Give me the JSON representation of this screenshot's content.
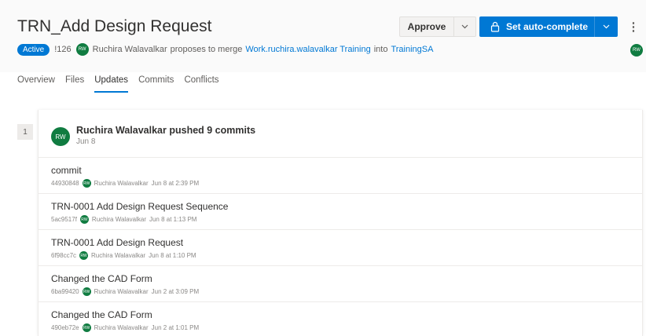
{
  "header": {
    "title": "TRN_Add Design Request",
    "approve_label": "Approve",
    "auto_complete_label": "Set auto-complete",
    "more_label": "⋮"
  },
  "meta": {
    "status": "Active",
    "pr_id": "!126",
    "author_initials": "RW",
    "author": "Ruchira Walavalkar",
    "proposes_text": "proposes to merge",
    "source_branch": "Work.ruchira.walavalkar Training",
    "into_text": "into",
    "target_branch": "TrainingSA"
  },
  "tabs": [
    "Overview",
    "Files",
    "Updates",
    "Commits",
    "Conflicts"
  ],
  "active_tab": "Updates",
  "update": {
    "number": "1",
    "initials": "RW",
    "title": "Ruchira Walavalkar pushed 9 commits",
    "date": "Jun 8"
  },
  "commits": [
    {
      "message": "commit",
      "hash": "44930848",
      "author": "Ruchira Walavalkar",
      "time": "Jun 8 at 2:39 PM"
    },
    {
      "message": "TRN-0001 Add Design Request Sequence",
      "hash": "5ac9517f",
      "author": "Ruchira Walavalkar",
      "time": "Jun 8 at 1:13 PM"
    },
    {
      "message": "TRN-0001 Add Design Request",
      "hash": "6f98cc7c",
      "author": "Ruchira Walavalkar",
      "time": "Jun 8 at 1:10 PM"
    },
    {
      "message": "Changed the CAD Form",
      "hash": "6ba99420",
      "author": "Ruchira Walavalkar",
      "time": "Jun 2 at 3:09 PM"
    },
    {
      "message": "Changed the CAD Form",
      "hash": "490eb72e",
      "author": "Ruchira Walavalkar",
      "time": "Jun 2 at 1:01 PM"
    }
  ],
  "colors": {
    "accent": "#0078d4",
    "avatar": "#107c41"
  }
}
